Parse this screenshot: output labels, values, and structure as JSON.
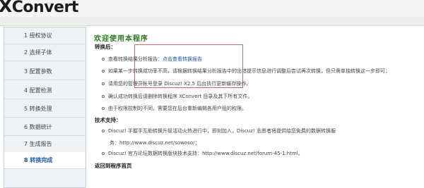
{
  "header": {
    "logo_x": "X",
    "logo_rest": "Convert"
  },
  "sidebar": {
    "items": [
      {
        "label": "1  授权协议"
      },
      {
        "label": "2  选择子体"
      },
      {
        "label": "3  配置参数"
      },
      {
        "label": "4  配置检测"
      },
      {
        "label": "5  转换处理"
      },
      {
        "label": "6  数据统计"
      },
      {
        "label": "7  生成报告"
      },
      {
        "label": "8  转换完成"
      }
    ]
  },
  "main": {
    "title": "欢迎使用本程序",
    "after_heading": "转换后：",
    "after_items": [
      {
        "text": "查看转换结果分析报告：",
        "link": "点击查看转换报告"
      },
      {
        "text": "如果某一步转换成功率不高，请根据转换结果分析报告中的出错提示信息进行调整后尝试再次转换，但只需单独转换这一步即可；"
      },
      {
        "text": "请用您的管理员帐号登录 Discuz! X2.5 后台执行更新缓存操作。"
      },
      {
        "text": "确认成功转换后请删除转换程序 XConvert 目录及其下所有文件。"
      },
      {
        "text": "由于权限控制的不同，需要您在后台重新编辑各用户组的权限。"
      }
    ],
    "support_heading": "技术支持：",
    "support_items": [
      {
        "text": "Discuz! 手握手互助转换升级活动火热进行中，即刻加入，Discuz! 志愿者将提供给您免费的数据转换服",
        "cont": "务：http://www.discuz.net/sowoso/；"
      },
      {
        "text": "Discuz! 官方论坛数据转换版块技术支持：http://www.discuz.net/forum-45-1.html。"
      }
    ],
    "back_link": "返回到程序首页"
  }
}
